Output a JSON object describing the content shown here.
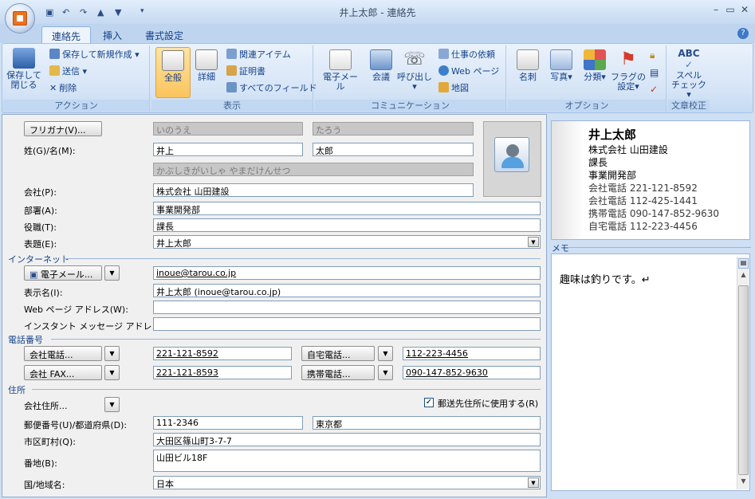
{
  "window": {
    "title": "井上太郎 - 連絡先"
  },
  "tabs": [
    "連絡先",
    "挿入",
    "書式設定"
  ],
  "ribbon": {
    "action": {
      "label": "アクション",
      "save_close": [
        "保存して",
        "閉じる"
      ],
      "save_new": "保存して新規作成",
      "send": "送信",
      "delete": "削除"
    },
    "view": {
      "label": "表示",
      "general": "全般",
      "detail": "詳細",
      "related": "関連アイテム",
      "certificate": "証明書",
      "all_fields": "すべてのフィールド"
    },
    "comm": {
      "label": "コミュニケーション",
      "email": "電子メール",
      "meeting": "会議",
      "call": "呼び出し",
      "task": "仕事の依頼",
      "web": "Web ページ",
      "map": "地図"
    },
    "options": {
      "label": "オプション",
      "card": "名刺",
      "picture": "写真",
      "category": "分類",
      "flag": [
        "フラグの",
        "設定"
      ]
    },
    "proof": {
      "label": "文章校正",
      "spell": [
        "スペル",
        "チェック"
      ],
      "abc": "ABC"
    }
  },
  "form": {
    "furigana_btn": "フリガナ(V)...",
    "furigana_last": "いのうえ",
    "furigana_first": "たろう",
    "name_label": "姓(G)/名(M):",
    "last_name": "井上",
    "first_name": "太郎",
    "company_kana": "かぶしきがいしゃ やまだけんせつ",
    "company_label": "会社(P):",
    "company": "株式会社 山田建設",
    "dept_label": "部署(A):",
    "dept": "事業開発部",
    "title_label": "役職(T):",
    "title": "課長",
    "display_label": "表題(E):",
    "display": "井上太郎",
    "internet_section": "インターネット",
    "email_btn": "電子メール...",
    "email": "inoue@tarou.co.jp",
    "dispname_label": "表示名(I):",
    "dispname": "井上太郎 (inoue@tarou.co.jp)",
    "web_label": "Web ページ アドレス(W):",
    "im_label": "インスタント メッセージ アドレス(",
    "phone_section": "電話番号",
    "phone_business_btn": "会社電話...",
    "phone_business": "221-121-8592",
    "phone_home_btn": "自宅電話...",
    "phone_home": "112-223-4456",
    "fax_btn": "会社 FAX...",
    "fax": "221-121-8593",
    "mobile_btn": "携帯電話...",
    "mobile": "090-147-852-9630",
    "address_section": "住所",
    "address_type": "会社住所...",
    "mailing_check": "郵送先住所に使用する(R)",
    "zip_label": "郵便番号(U)/都道府県(D):",
    "zip": "111-2346",
    "prefecture": "東京都",
    "city_label": "市区町村(Q):",
    "city": "大田区篠山町3-7-7",
    "street_label": "番地(B):",
    "street": "山田ビル18F",
    "country_label": "国/地域名:",
    "country": "日本"
  },
  "card": {
    "name": "井上太郎",
    "company": "株式会社 山田建設",
    "title": "課長",
    "dept": "事業開発部",
    "lines": [
      "会社電話 221-121-8592",
      "会社電話 112-425-1441",
      "携帯電話 090-147-852-9630",
      "自宅電話 112-223-4456"
    ]
  },
  "memo": {
    "label": "メモ",
    "text": "趣味は釣りです。↵"
  },
  "colors": {
    "accent": "#15428b",
    "ribbon": "#d5e4f6",
    "selected": "#fbc45b"
  }
}
